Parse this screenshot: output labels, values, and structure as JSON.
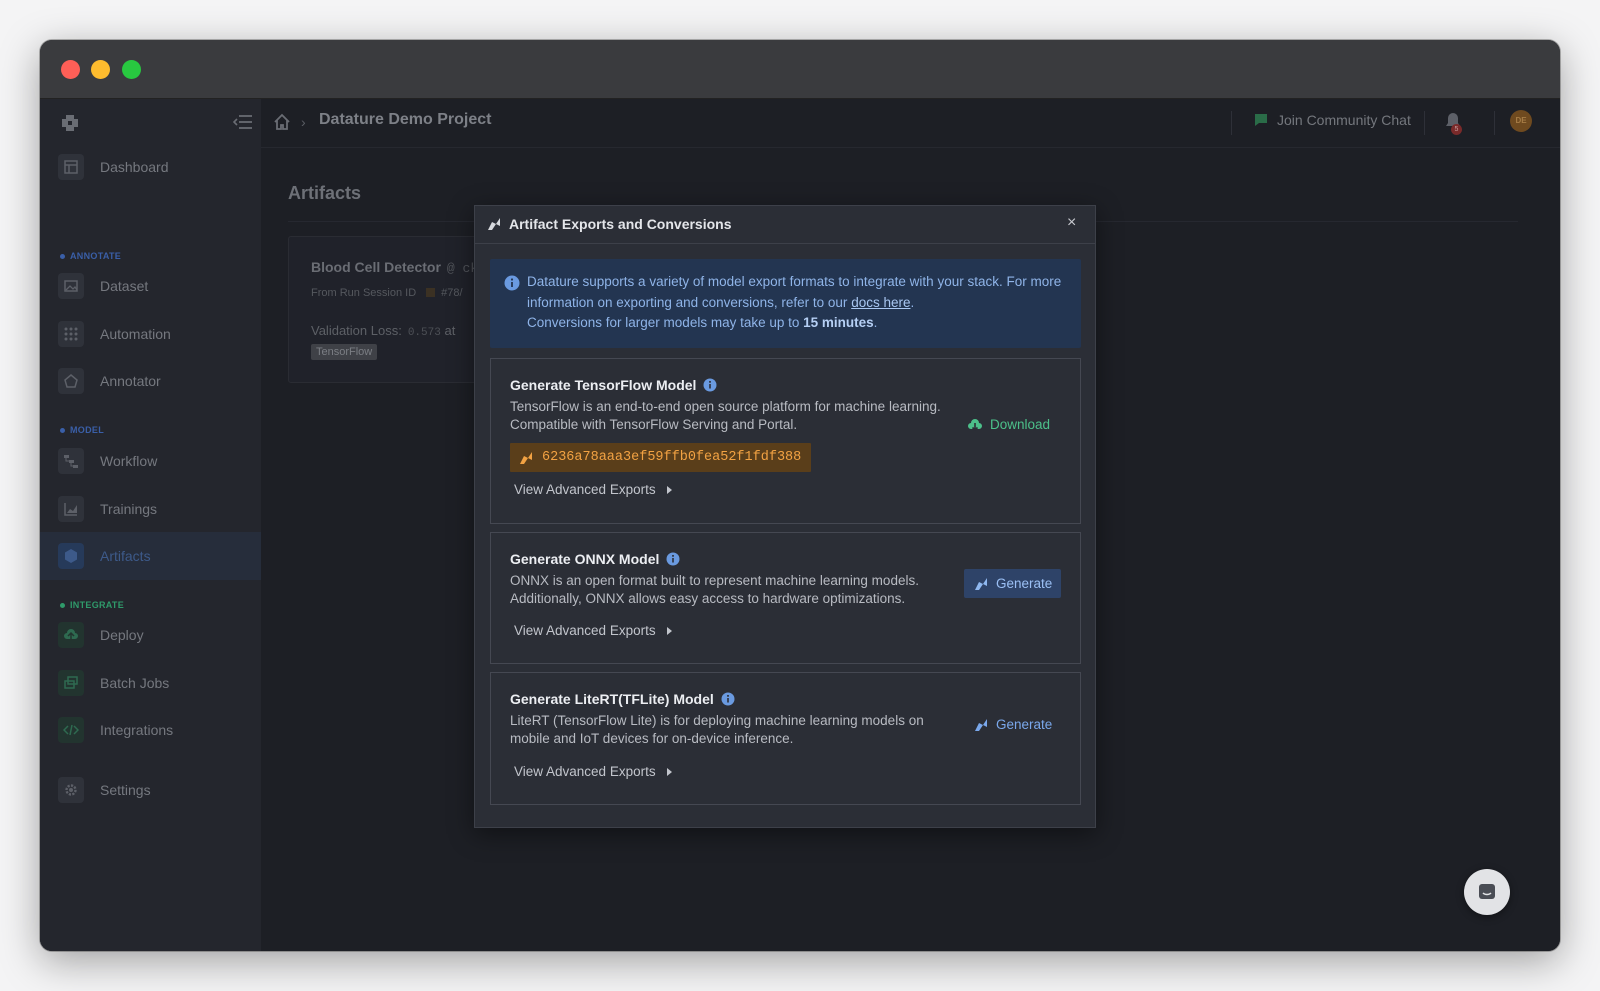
{
  "window": {
    "lights": [
      "close",
      "minimize",
      "maximize"
    ]
  },
  "sidebar": {
    "items": [
      {
        "label": "Dashboard",
        "icon": "dashboard-icon"
      },
      {
        "label": "Dataset",
        "icon": "image-icon"
      },
      {
        "label": "Automation",
        "icon": "grid-icon"
      },
      {
        "label": "Annotator",
        "icon": "annotator-icon"
      },
      {
        "label": "Workflow",
        "icon": "workflow-icon"
      },
      {
        "label": "Trainings",
        "icon": "chart-icon"
      },
      {
        "label": "Artifacts",
        "icon": "cube-icon",
        "active": true
      },
      {
        "label": "Deploy",
        "icon": "cloud-upload-icon"
      },
      {
        "label": "Batch Jobs",
        "icon": "layers-icon"
      },
      {
        "label": "Integrations",
        "icon": "code-icon"
      },
      {
        "label": "Settings",
        "icon": "gear-icon"
      }
    ],
    "sections": {
      "annotate": "ANNOTATE",
      "model": "MODEL",
      "integrate": "INTEGRATE"
    }
  },
  "topbar": {
    "project": "Datature Demo Project",
    "community": "Join Community Chat",
    "notifications": "5",
    "avatar": "DE"
  },
  "main": {
    "title": "Artifacts",
    "card": {
      "title": "Blood Cell Detector",
      "at": "@ ckp",
      "run_label": "From Run Session ID",
      "run_id": "#78/",
      "loss_label": "Validation Loss:",
      "loss_value": "0.573",
      "loss_suffix": "at",
      "tag": "TensorFlow"
    }
  },
  "modal": {
    "title": "Artifact Exports and Conversions",
    "close": "×",
    "info": {
      "text1": "Datature supports a variety of model export formats to integrate with your stack. For more information on exporting and conversions, refer to our ",
      "link": "docs here",
      "text2": ".",
      "text3": "Conversions for larger models may take up to ",
      "bold": "15 minutes",
      "text4": "."
    },
    "exports": [
      {
        "title": "Generate TensorFlow Model",
        "desc": "TensorFlow is an end-to-end open source platform for machine learning. Compatible with TensorFlow Serving and Portal.",
        "hash": "6236a78aaa3ef59ffb0fea52f1fdf388",
        "action": "Download",
        "advanced": "View Advanced Exports"
      },
      {
        "title": "Generate ONNX Model",
        "desc": "ONNX is an open format built to represent machine learning models. Additionally, ONNX allows easy access to hardware optimizations.",
        "action": "Generate",
        "advanced": "View Advanced Exports"
      },
      {
        "title": "Generate LiteRT(TFLite) Model",
        "desc": "LiteRT (TensorFlow Lite) is for deploying machine learning models on mobile and IoT devices for on-device inference.",
        "action": "Generate",
        "advanced": "View Advanced Exports"
      }
    ]
  },
  "colors": {
    "accent_blue": "#7aa8ec",
    "download_green": "#4cc08a",
    "hash_orange": "#f2a243",
    "annotate_section": "#3a5fa8",
    "model_section": "#3a5fa8",
    "integrate_section": "#2f9a6a"
  }
}
